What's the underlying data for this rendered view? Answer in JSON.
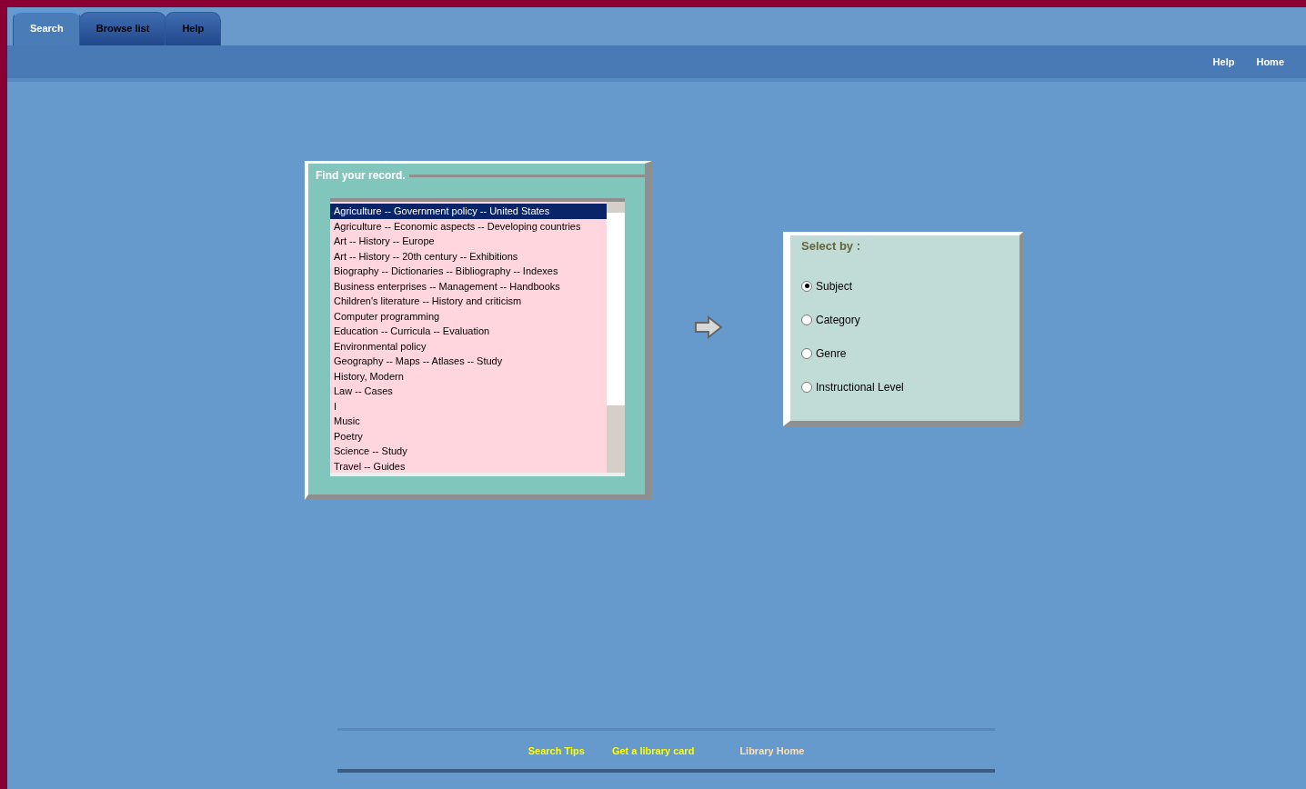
{
  "tabs": [
    {
      "label": "Search",
      "selected": true
    },
    {
      "label": "Browse list",
      "selected": false
    },
    {
      "label": "Help",
      "selected": false
    }
  ],
  "header_links": [
    "Help",
    "Home"
  ],
  "list_panel": {
    "title": "Find your record.",
    "items": [
      {
        "label": "Agriculture -- Government policy -- United States",
        "selected": true
      },
      {
        "label": "Agriculture -- Economic aspects -- Developing countries",
        "selected": false
      },
      {
        "label": "Art -- History -- Europe",
        "selected": false
      },
      {
        "label": "Art -- History -- 20th century -- Exhibitions",
        "selected": false
      },
      {
        "label": "Biography -- Dictionaries -- Bibliography -- Indexes",
        "selected": false
      },
      {
        "label": "Business enterprises -- Management -- Handbooks",
        "selected": false
      },
      {
        "label": "Children's literature -- History and criticism",
        "selected": false
      },
      {
        "label": "Computer programming",
        "selected": false
      },
      {
        "label": "Education -- Curricula -- Evaluation",
        "selected": false
      },
      {
        "label": "Environmental policy",
        "selected": false
      },
      {
        "label": "Geography -- Maps -- Atlases -- Study",
        "selected": false
      },
      {
        "label": "History, Modern",
        "selected": false
      },
      {
        "label": "Law -- Cases",
        "selected": false
      },
      {
        "label": "I",
        "selected": false
      },
      {
        "label": "Music",
        "selected": false
      },
      {
        "label": "Poetry",
        "selected": false
      },
      {
        "label": "Science -- Study",
        "selected": false
      },
      {
        "label": "Travel -- Guides",
        "selected": false
      }
    ]
  },
  "select_panel": {
    "title": "Select by :",
    "options": [
      {
        "label": "Subject",
        "selected": true
      },
      {
        "label": "Category",
        "selected": false
      },
      {
        "label": "Genre",
        "selected": false
      },
      {
        "label": "Instructional Level",
        "selected": false
      }
    ]
  },
  "footer_links": [
    {
      "label": "Search Tips",
      "kind": "link"
    },
    {
      "label": "Get a library card",
      "kind": "link"
    },
    {
      "label": "Library Home",
      "kind": "home"
    }
  ]
}
